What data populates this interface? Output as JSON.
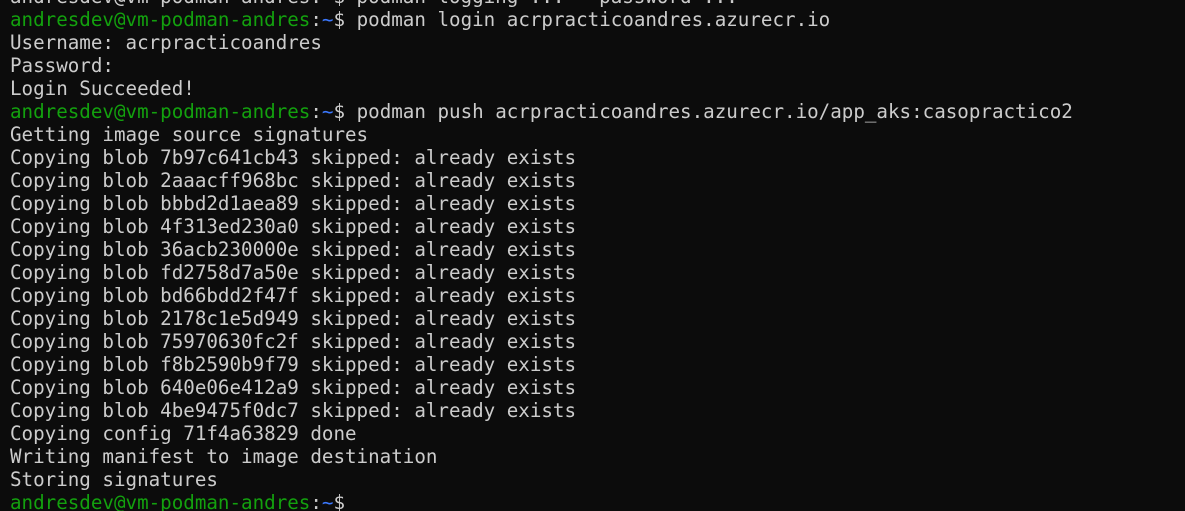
{
  "terminal": {
    "partial_top_line": "andresdev@vm-podman-andres:~$ podman logging ... --password ...",
    "prompt_user_host": "andresdev@vm-podman-andres",
    "prompt_colon": ":",
    "prompt_path": "~",
    "prompt_symbol": "$",
    "lines": [
      {
        "type": "prompt",
        "command": " podman login acrpracticoandres.azurecr.io"
      },
      {
        "type": "output",
        "text": "Username: acrpracticoandres"
      },
      {
        "type": "output",
        "text": "Password:"
      },
      {
        "type": "output",
        "text": "Login Succeeded!"
      },
      {
        "type": "prompt",
        "command": " podman push acrpracticoandres.azurecr.io/app_aks:casopractico2"
      },
      {
        "type": "output",
        "text": "Getting image source signatures"
      },
      {
        "type": "output",
        "text": "Copying blob 7b97c641cb43 skipped: already exists"
      },
      {
        "type": "output",
        "text": "Copying blob 2aaacff968bc skipped: already exists"
      },
      {
        "type": "output",
        "text": "Copying blob bbbd2d1aea89 skipped: already exists"
      },
      {
        "type": "output",
        "text": "Copying blob 4f313ed230a0 skipped: already exists"
      },
      {
        "type": "output",
        "text": "Copying blob 36acb230000e skipped: already exists"
      },
      {
        "type": "output",
        "text": "Copying blob fd2758d7a50e skipped: already exists"
      },
      {
        "type": "output",
        "text": "Copying blob bd66bdd2f47f skipped: already exists"
      },
      {
        "type": "output",
        "text": "Copying blob 2178c1e5d949 skipped: already exists"
      },
      {
        "type": "output",
        "text": "Copying blob 75970630fc2f skipped: already exists"
      },
      {
        "type": "output",
        "text": "Copying blob f8b2590b9f79 skipped: already exists"
      },
      {
        "type": "output",
        "text": "Copying blob 640e06e412a9 skipped: already exists"
      },
      {
        "type": "output",
        "text": "Copying blob 4be9475f0dc7 skipped: already exists"
      },
      {
        "type": "output",
        "text": "Copying config 71f4a63829 done"
      },
      {
        "type": "output",
        "text": "Writing manifest to image destination"
      },
      {
        "type": "output",
        "text": "Storing signatures"
      },
      {
        "type": "prompt",
        "command": ""
      }
    ],
    "colors": {
      "background": "#0c0c0c",
      "foreground": "#cccccc",
      "user_host": "#13a10e",
      "path": "#3b78ff"
    }
  }
}
